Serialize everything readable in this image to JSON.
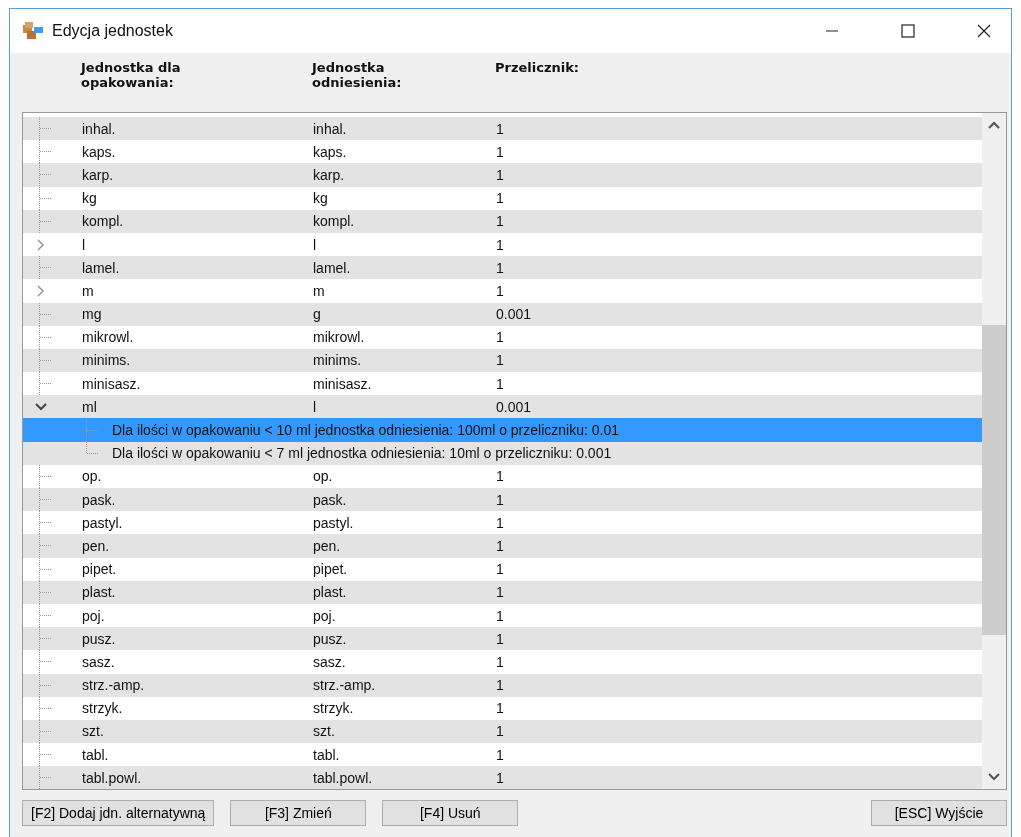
{
  "window": {
    "title": "Edycja jednostek"
  },
  "columns": [
    "Jednostka dla opakowania:",
    "Jednostka odniesienia:",
    "Przelicznik:"
  ],
  "rows": [
    {
      "unit": "inhal.",
      "reference": "inhal.",
      "factor": "1",
      "selected": false
    },
    {
      "unit": "kaps.",
      "reference": "kaps.",
      "factor": "1",
      "selected": false
    },
    {
      "unit": "karp.",
      "reference": "karp.",
      "factor": "1",
      "selected": false
    },
    {
      "unit": "kg",
      "reference": "kg",
      "factor": "1",
      "selected": false
    },
    {
      "unit": "kompl.",
      "reference": "kompl.",
      "factor": "1",
      "selected": false
    },
    {
      "unit": "l",
      "reference": "l",
      "factor": "1",
      "selected": false,
      "expanded": false
    },
    {
      "unit": "lamel.",
      "reference": "lamel.",
      "factor": "1",
      "selected": false
    },
    {
      "unit": "m",
      "reference": "m",
      "factor": "1",
      "selected": false,
      "expanded": false
    },
    {
      "unit": "mg",
      "reference": "g",
      "factor": "0.001",
      "selected": false
    },
    {
      "unit": "mikrowl.",
      "reference": "mikrowl.",
      "factor": "1",
      "selected": false
    },
    {
      "unit": "minims.",
      "reference": "minims.",
      "factor": "1",
      "selected": false
    },
    {
      "unit": "minisasz.",
      "reference": "minisasz.",
      "factor": "1",
      "selected": false
    },
    {
      "unit": "ml",
      "reference": "l",
      "factor": "0.001",
      "selected": false,
      "expanded": true,
      "children": [
        {
          "text": "Dla ilości w opakowaniu < 10 ml jednostka odniesienia: 100ml o przeliczniku: 0.01",
          "selected": true
        },
        {
          "text": "Dla ilości w opakowaniu < 7 ml jednostka odniesienia: 10ml o przeliczniku: 0.001",
          "selected": false
        }
      ]
    },
    {
      "unit": "op.",
      "reference": "op.",
      "factor": "1",
      "selected": false
    },
    {
      "unit": "pask.",
      "reference": "pask.",
      "factor": "1",
      "selected": false
    },
    {
      "unit": "pastyl.",
      "reference": "pastyl.",
      "factor": "1",
      "selected": false
    },
    {
      "unit": "pen.",
      "reference": "pen.",
      "factor": "1",
      "selected": false
    },
    {
      "unit": "pipet.",
      "reference": "pipet.",
      "factor": "1",
      "selected": false
    },
    {
      "unit": "plast.",
      "reference": "plast.",
      "factor": "1",
      "selected": false
    },
    {
      "unit": "poj.",
      "reference": "poj.",
      "factor": "1",
      "selected": false
    },
    {
      "unit": "pusz.",
      "reference": "pusz.",
      "factor": "1",
      "selected": false
    },
    {
      "unit": "sasz.",
      "reference": "sasz.",
      "factor": "1",
      "selected": false
    },
    {
      "unit": "strz.-amp.",
      "reference": "strz.-amp.",
      "factor": "1",
      "selected": false
    },
    {
      "unit": "strzyk.",
      "reference": "strzyk.",
      "factor": "1",
      "selected": false
    },
    {
      "unit": "szt.",
      "reference": "szt.",
      "factor": "1",
      "selected": false
    },
    {
      "unit": "tabl.",
      "reference": "tabl.",
      "factor": "1",
      "selected": false
    },
    {
      "unit": "tabl.powl.",
      "reference": "tabl.powl.",
      "factor": "1",
      "selected": false
    }
  ],
  "buttons": [
    "[F2] Dodaj jdn. alternatywną",
    "[F3] Zmień",
    "[F4] Usuń",
    "[ESC] Wyjście"
  ]
}
